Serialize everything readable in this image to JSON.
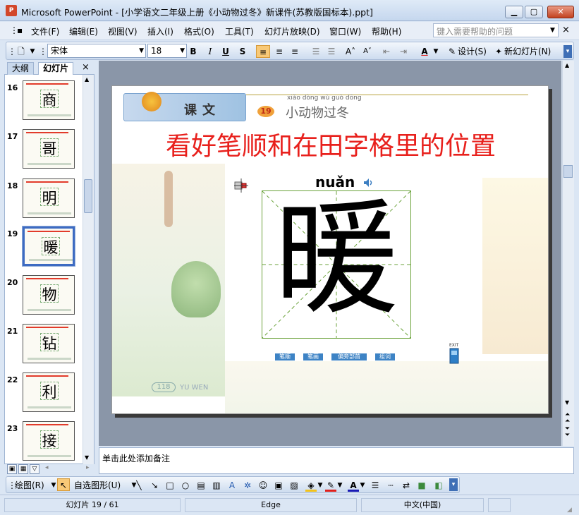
{
  "window": {
    "app_icon_text": "P",
    "title": "Microsoft PowerPoint - [小学语文二年级上册《小动物过冬》新课件(苏教版国标本).ppt]",
    "min_symbol": "▁",
    "max_symbol": "▢",
    "close_symbol": "✕"
  },
  "menu": {
    "items": [
      "文件(F)",
      "编辑(E)",
      "视图(V)",
      "插入(I)",
      "格式(O)",
      "工具(T)",
      "幻灯片放映(D)",
      "窗口(W)",
      "帮助(H)"
    ],
    "help_placeholder": "键入需要帮助的问题",
    "help_close": "×"
  },
  "toolbar": {
    "font_name": "宋体",
    "font_size": "18",
    "bold": "B",
    "italic": "I",
    "underline": "U",
    "shadow": "S",
    "design_label": "设计(S)",
    "new_slide_label": "新幻灯片(N)"
  },
  "left_pane": {
    "tabs": [
      "大纲",
      "幻灯片"
    ],
    "close": "×",
    "thumbnails": [
      {
        "number": "16",
        "char": "商",
        "selected": false
      },
      {
        "number": "17",
        "char": "哥",
        "selected": false
      },
      {
        "number": "18",
        "char": "明",
        "selected": false
      },
      {
        "number": "19",
        "char": "暖",
        "selected": true
      },
      {
        "number": "20",
        "char": "物",
        "selected": false
      },
      {
        "number": "21",
        "char": "钻",
        "selected": false
      },
      {
        "number": "22",
        "char": "利",
        "selected": false
      },
      {
        "number": "23",
        "char": "接",
        "selected": false
      }
    ]
  },
  "slide": {
    "banner_text": "课文",
    "lesson_number": "19",
    "lesson_pinyin": "xiǎo dòng wù guò dōng",
    "lesson_title": "小动物过冬",
    "instruction": "看好笔顺和在田字格里的位置",
    "pinyin": "nuǎn",
    "character": "暖",
    "controls": [
      "笔顺",
      "笔画",
      "偏旁部首",
      "组词"
    ],
    "exit_label": "EXIT",
    "page_number": "118",
    "footer_text": "YU WEN"
  },
  "notes": {
    "placeholder": "单击此处添加备注"
  },
  "draw_toolbar": {
    "draw_label": "绘图(R)",
    "autoshapes_label": "自选图形(U)"
  },
  "status": {
    "slide_info": "幻灯片 19 / 61",
    "design_name": "Edge",
    "language": "中文(中国)"
  },
  "colors": {
    "instruction_red": "#e8201c",
    "grid_green": "#6aa23a",
    "selection_blue": "#3d6bc2"
  }
}
